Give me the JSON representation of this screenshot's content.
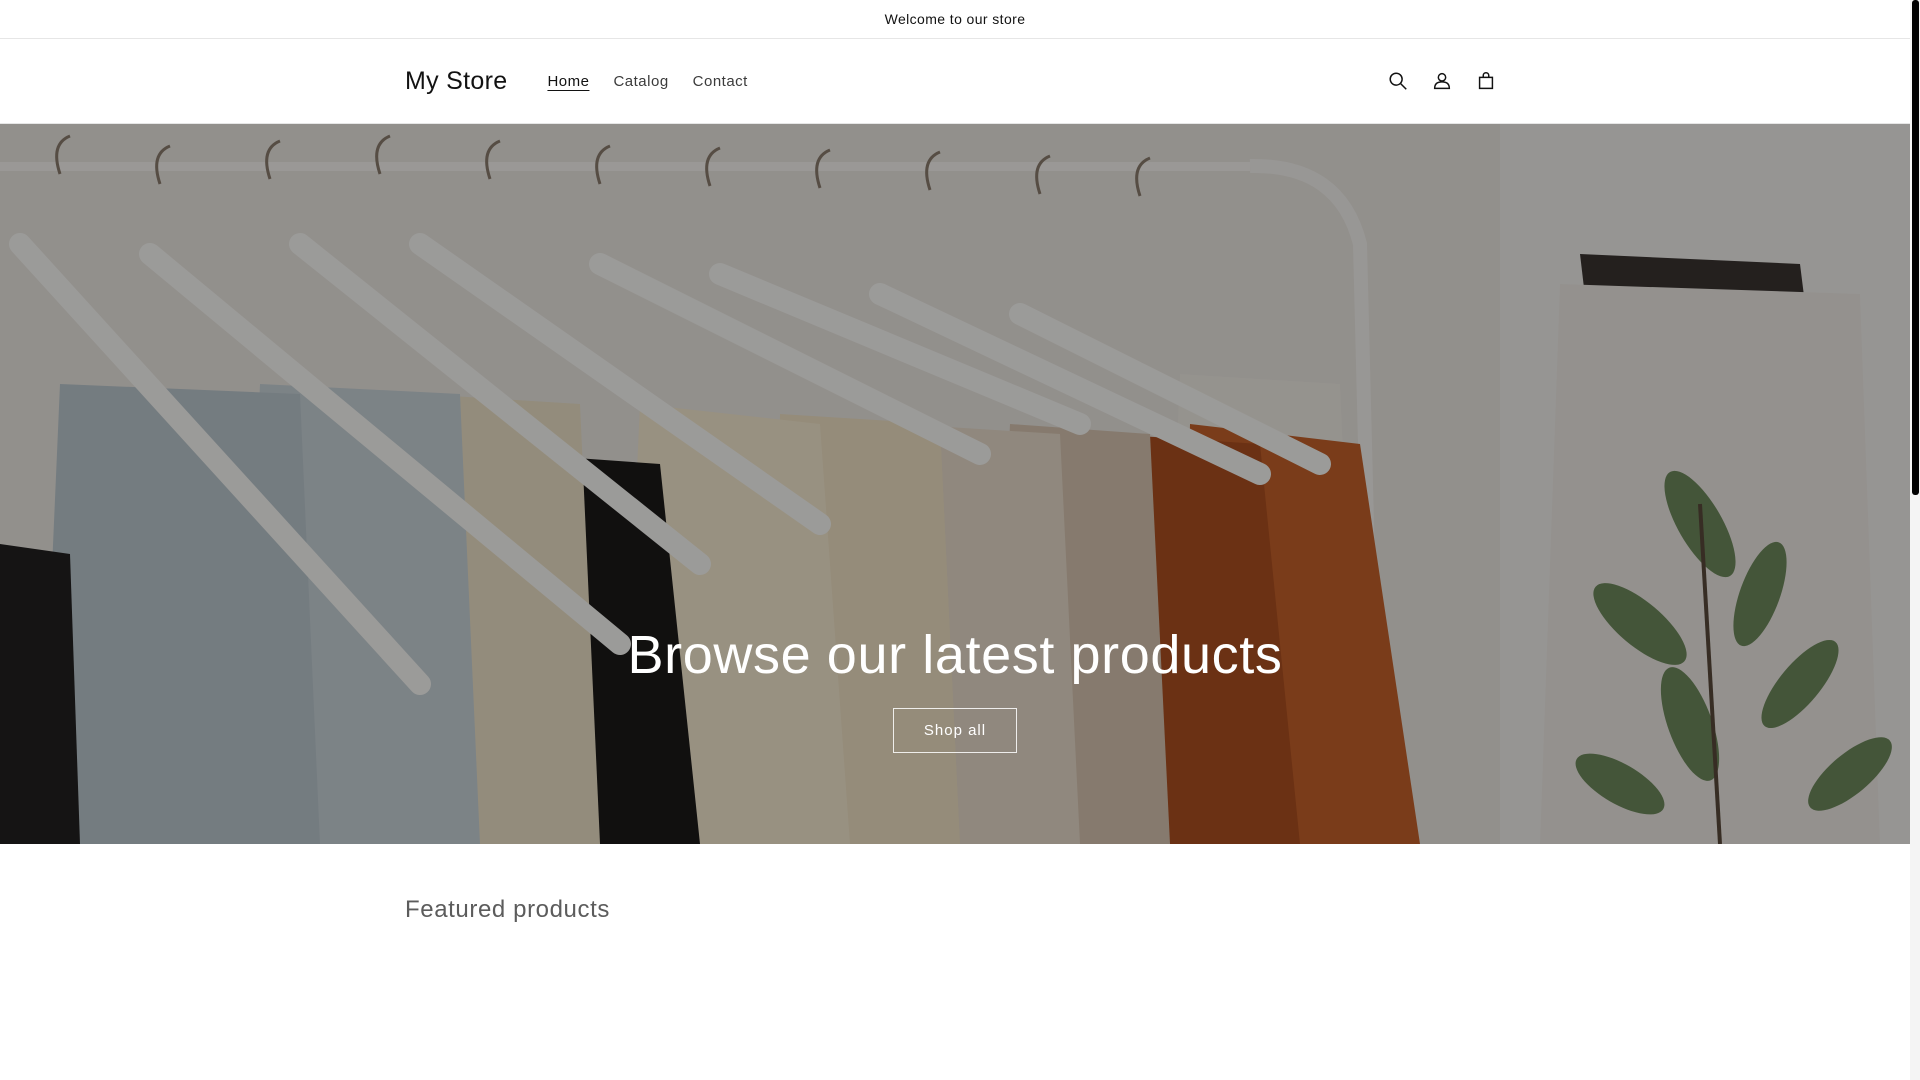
{
  "announcement": {
    "text": "Welcome to our store"
  },
  "header": {
    "logo": "My Store",
    "nav": [
      {
        "label": "Home",
        "active": true
      },
      {
        "label": "Catalog",
        "active": false
      },
      {
        "label": "Contact",
        "active": false
      }
    ],
    "icons": [
      "search-icon",
      "account-icon",
      "cart-icon"
    ]
  },
  "hero": {
    "title": "Browse our latest products",
    "button_label": "Shop all"
  },
  "featured": {
    "title": "Featured products"
  },
  "colors": {
    "text": "#121212",
    "muted": "#5c5c5c",
    "hero_overlay": "#000000",
    "orange_garment": "#c5622a"
  }
}
